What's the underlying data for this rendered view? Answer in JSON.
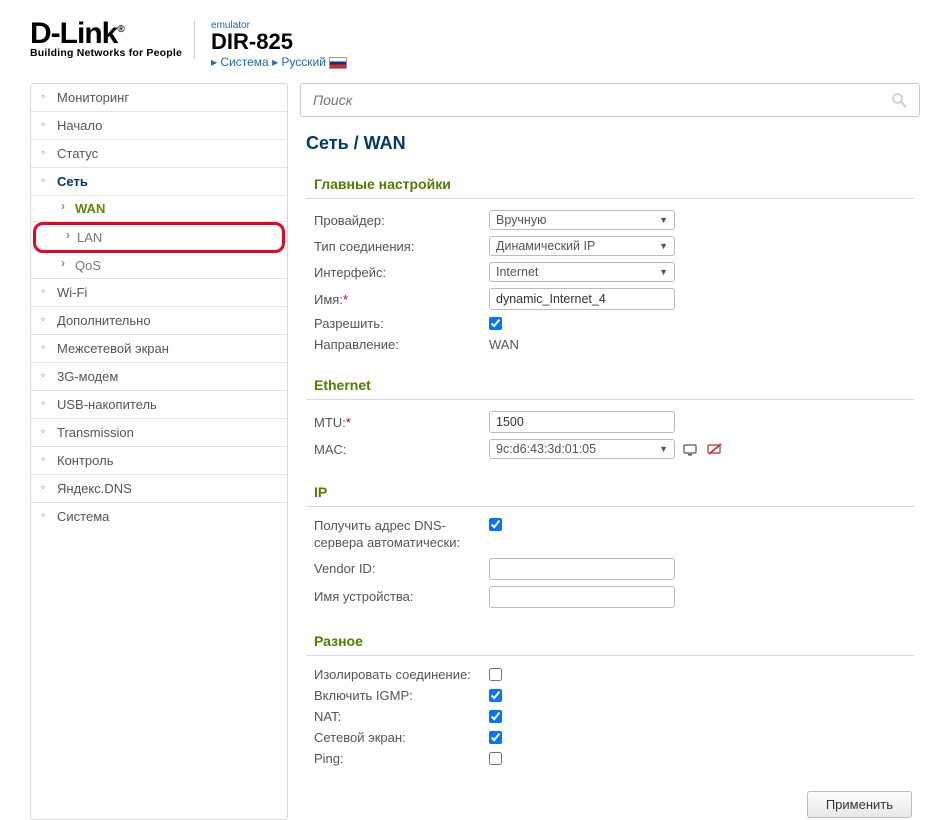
{
  "header": {
    "logo_main": "D-Link",
    "logo_sub": "Building Networks for People",
    "emulator": "emulator",
    "model": "DIR-825",
    "crumb_system": "Система",
    "crumb_lang": "Русский"
  },
  "search": {
    "placeholder": "Поиск"
  },
  "sidebar": {
    "items": [
      {
        "label": "Мониторинг"
      },
      {
        "label": "Начало"
      },
      {
        "label": "Статус"
      },
      {
        "label": "Сеть",
        "active": true,
        "sub": [
          {
            "label": "WAN",
            "current": true
          },
          {
            "label": "LAN",
            "highlight": true
          },
          {
            "label": "QoS"
          }
        ]
      },
      {
        "label": "Wi-Fi"
      },
      {
        "label": "Дополнительно"
      },
      {
        "label": "Межсетевой экран"
      },
      {
        "label": "3G-модем"
      },
      {
        "label": "USB-накопитель"
      },
      {
        "label": "Transmission"
      },
      {
        "label": "Контроль"
      },
      {
        "label": "Яндекс.DNS"
      },
      {
        "label": "Система"
      }
    ]
  },
  "page_title": "Сеть  /  WAN",
  "sections": {
    "main": {
      "title": "Главные настройки",
      "provider_label": "Провайдер:",
      "provider_value": "Вручную",
      "conn_type_label": "Тип соединения:",
      "conn_type_value": "Динамический IP",
      "iface_label": "Интерфейс:",
      "iface_value": "Internet",
      "name_label": "Имя:",
      "name_value": "dynamic_Internet_4",
      "allow_label": "Разрешить:",
      "direction_label": "Направление:",
      "direction_value": "WAN"
    },
    "eth": {
      "title": "Ethernet",
      "mtu_label": "MTU:",
      "mtu_value": "1500",
      "mac_label": "MAC:",
      "mac_value": "9c:d6:43:3d:01:05"
    },
    "ip": {
      "title": "IP",
      "dns_label": "Получить адрес DNS-сервера автоматически:",
      "vendor_label": "Vendor ID:",
      "devname_label": "Имя устройства:"
    },
    "misc": {
      "title": "Разное",
      "isolate_label": "Изолировать соединение:",
      "igmp_label": "Включить IGMP:",
      "nat_label": "NAT:",
      "fw_label": "Сетевой экран:",
      "ping_label": "Ping:"
    }
  },
  "apply_button": "Применить"
}
